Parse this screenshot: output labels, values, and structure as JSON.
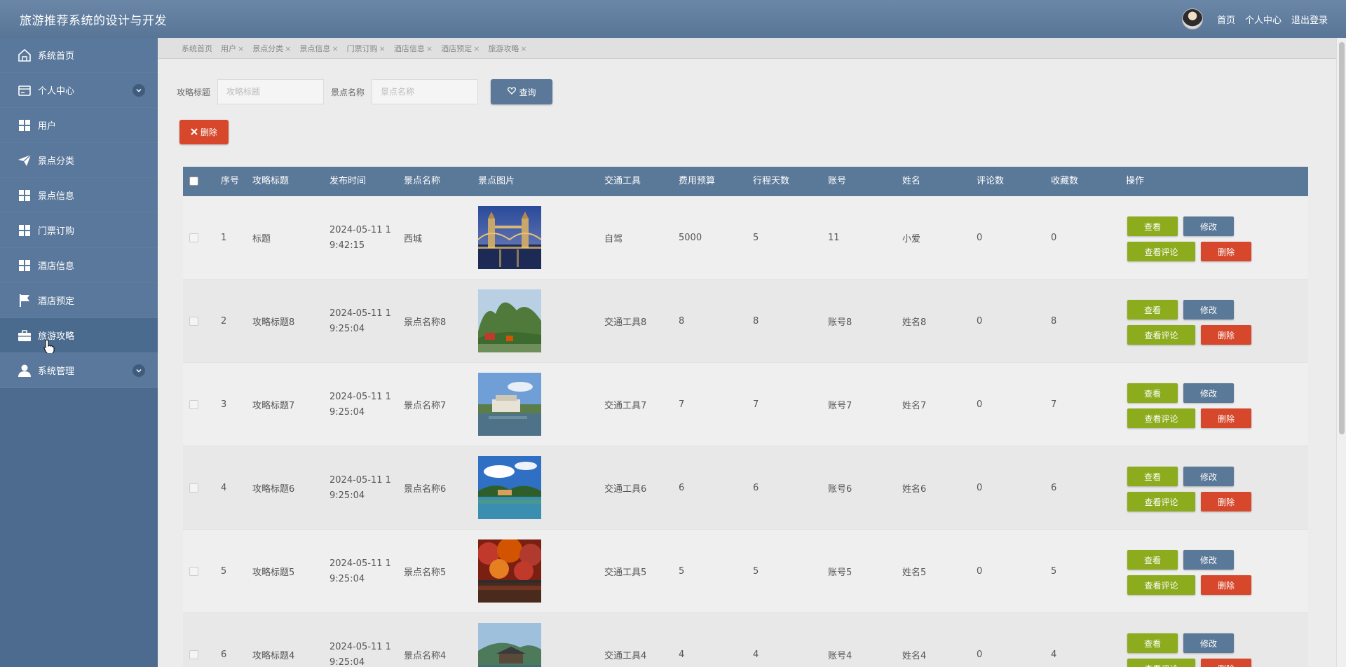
{
  "header": {
    "title": "旅游推荐系统的设计与开发",
    "links": [
      "首页",
      "个人中心",
      "退出登录"
    ]
  },
  "sidebar": {
    "items": [
      {
        "label": "系统首页",
        "icon": "home-icon"
      },
      {
        "label": "个人中心",
        "icon": "card-icon",
        "expandable": true
      },
      {
        "label": "用户",
        "icon": "grid-icon"
      },
      {
        "label": "景点分类",
        "icon": "paper-plane-icon"
      },
      {
        "label": "景点信息",
        "icon": "grid-icon"
      },
      {
        "label": "门票订购",
        "icon": "grid-icon"
      },
      {
        "label": "酒店信息",
        "icon": "grid-icon"
      },
      {
        "label": "酒店预定",
        "icon": "flag-icon"
      },
      {
        "label": "旅游攻略",
        "icon": "briefcase-icon",
        "active": true
      },
      {
        "label": "系统管理",
        "icon": "user-icon",
        "expandable": true
      }
    ]
  },
  "tabs": [
    {
      "label": "系统首页",
      "closable": false
    },
    {
      "label": "用户",
      "closable": true
    },
    {
      "label": "景点分类",
      "closable": true
    },
    {
      "label": "景点信息",
      "closable": true
    },
    {
      "label": "门票订购",
      "closable": true
    },
    {
      "label": "酒店信息",
      "closable": true
    },
    {
      "label": "酒店预定",
      "closable": true
    },
    {
      "label": "旅游攻略",
      "closable": true,
      "active": true
    }
  ],
  "search": {
    "title_label": "攻略标题",
    "title_placeholder": "攻略标题",
    "spot_label": "景点名称",
    "spot_placeholder": "景点名称",
    "query_button": "查询"
  },
  "toolbar": {
    "delete_label": "删除"
  },
  "table": {
    "columns": [
      "序号",
      "攻略标题",
      "发布时间",
      "景点名称",
      "景点图片",
      "交通工具",
      "费用预算",
      "行程天数",
      "账号",
      "姓名",
      "评论数",
      "收藏数",
      "操作"
    ],
    "actions": {
      "view": "查看",
      "edit": "修改",
      "comments": "查看评论",
      "delete": "删除"
    },
    "rows": [
      {
        "no": "1",
        "title": "标题",
        "time": "2024-05-11 19:42:15",
        "spot": "西城",
        "image": "tower-bridge-night",
        "transport": "自驾",
        "budget": "5000",
        "days": "5",
        "account": "11",
        "name": "小爱",
        "comments": "0",
        "favorites": "0"
      },
      {
        "no": "2",
        "title": "攻略标题8",
        "time": "2024-05-11 19:25:04",
        "spot": "景点名称8",
        "image": "karst-mountain",
        "transport": "交通工具8",
        "budget": "8",
        "days": "8",
        "account": "账号8",
        "name": "姓名8",
        "comments": "0",
        "favorites": "8"
      },
      {
        "no": "3",
        "title": "攻略标题7",
        "time": "2024-05-11 19:25:04",
        "spot": "景点名称7",
        "image": "boat-lake",
        "transport": "交通工具7",
        "budget": "7",
        "days": "7",
        "account": "账号7",
        "name": "姓名7",
        "comments": "0",
        "favorites": "7"
      },
      {
        "no": "4",
        "title": "攻略标题6",
        "time": "2024-05-11 19:25:04",
        "spot": "景点名称6",
        "image": "blue-lake",
        "transport": "交通工具6",
        "budget": "6",
        "days": "6",
        "account": "账号6",
        "name": "姓名6",
        "comments": "0",
        "favorites": "6"
      },
      {
        "no": "5",
        "title": "攻略标题5",
        "time": "2024-05-11 19:25:04",
        "spot": "景点名称5",
        "image": "autumn-trees",
        "transport": "交通工具5",
        "budget": "5",
        "days": "5",
        "account": "账号5",
        "name": "姓名5",
        "comments": "0",
        "favorites": "5"
      },
      {
        "no": "6",
        "title": "攻略标题4",
        "time": "2024-05-11 19:25:04",
        "spot": "景点名称4",
        "image": "pavilion-lake",
        "transport": "交通工具4",
        "budget": "4",
        "days": "4",
        "account": "账号4",
        "name": "姓名4",
        "comments": "0",
        "favorites": "4"
      }
    ]
  },
  "colors": {
    "header": "#587596",
    "sidebar": "#5a789b",
    "primary": "#5a7898",
    "success": "#8cab1d",
    "danger": "#d6472b"
  }
}
